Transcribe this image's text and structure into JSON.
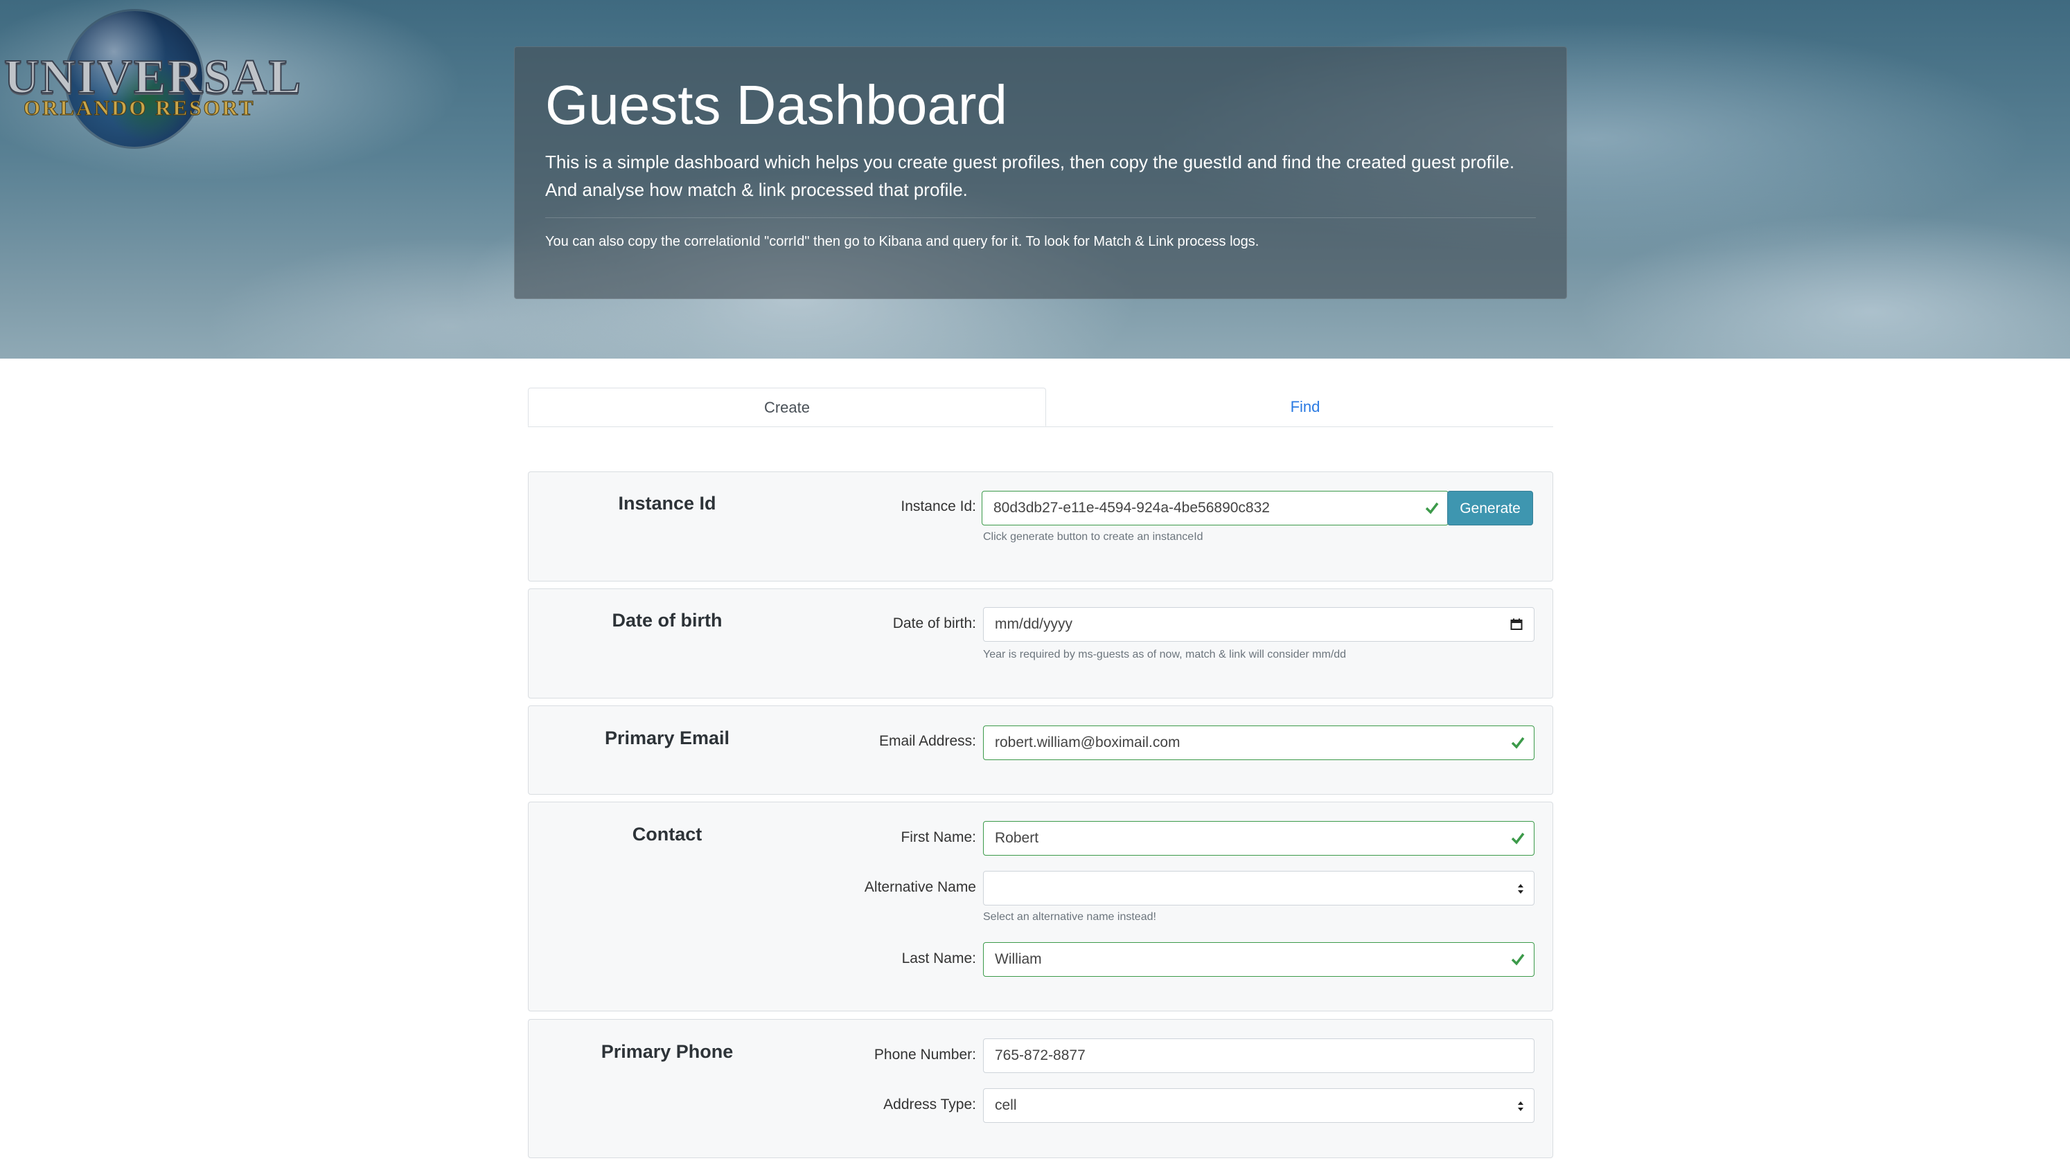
{
  "brand": {
    "line1": "UNIVERSAL",
    "line2": "ORLANDO RESORT"
  },
  "hero": {
    "title": "Guests Dashboard",
    "lead": "This is a simple dashboard which helps you create guest profiles, then copy the guestId and find the created guest profile. And analyse how match & link processed that profile.",
    "note": "You can also copy the correlationId \"corrId\" then go to Kibana and query for it. To look for Match & Link process logs."
  },
  "tabs": [
    {
      "label": "Create",
      "active": true
    },
    {
      "label": "Find",
      "active": false
    }
  ],
  "colors": {
    "valid": "#3c9a4a",
    "link": "#2a7ae2",
    "button": "#3e96b0"
  },
  "sections": {
    "instance": {
      "title": "Instance Id",
      "label": "Instance Id:",
      "value": "80d3db27-e11e-4594-924a-4be56890c832",
      "button": "Generate",
      "help": "Click generate button to create an instanceId"
    },
    "dob": {
      "title": "Date of birth",
      "label": "Date of birth:",
      "placeholder": "mm/dd/yyyy",
      "help": "Year is required by ms-guests as of now, match & link will consider mm/dd"
    },
    "email": {
      "title": "Primary Email",
      "label": "Email Address:",
      "value": "robert.william@boximail.com"
    },
    "contact": {
      "title": "Contact",
      "first_label": "First Name:",
      "first_value": "Robert",
      "alt_label": "Alternative Name",
      "alt_value": "",
      "alt_help": "Select an alternative name instead!",
      "last_label": "Last Name:",
      "last_value": "William"
    },
    "phone": {
      "title": "Primary Phone",
      "number_label": "Phone Number:",
      "number_value": "765-872-8877",
      "type_label": "Address Type:",
      "type_value": "cell"
    }
  }
}
